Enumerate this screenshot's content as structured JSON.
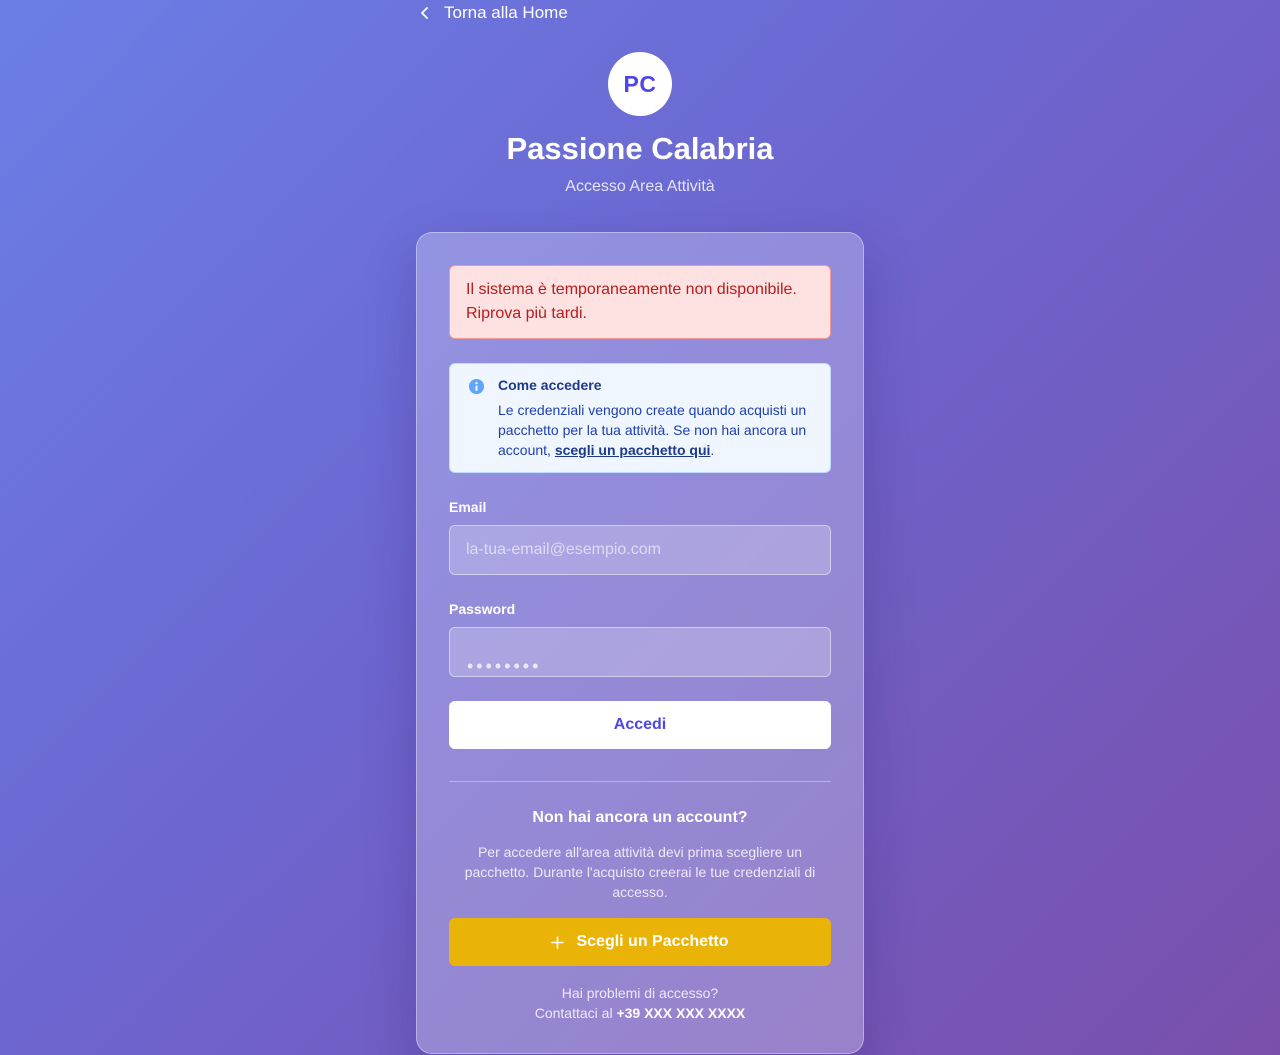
{
  "nav": {
    "back_label": "Torna alla Home"
  },
  "brand": {
    "logo_text": "PC",
    "title": "Passione Calabria",
    "subtitle": "Accesso Area Attività"
  },
  "error": {
    "message": "Il sistema è temporaneamente non disponibile. Riprova più tardi."
  },
  "info": {
    "icon": "info-circle-icon",
    "title": "Come accedere",
    "text": "Le credenziali vengono create quando acquisti un pacchetto per la tua attività. Se non hai ancora un account, ",
    "link_label": "scegli un pacchetto qui",
    "text_end": "."
  },
  "form": {
    "email_label": "Email",
    "email_placeholder": "la-tua-email@esempio.com",
    "email_value": "",
    "password_label": "Password",
    "password_placeholder": "••••••••",
    "password_value": "",
    "submit_label": "Accedi"
  },
  "signup": {
    "title": "Non hai ancora un account?",
    "description": "Per accedere all'area attività devi prima scegliere un pacchetto. Durante l'acquisto creerai le tue credenziali di accesso.",
    "button_label": "Scegli un Pacchetto",
    "button_icon": "plus-icon"
  },
  "help": {
    "question": "Hai problemi di accesso?",
    "contact_prefix": "Contattaci al ",
    "phone": "+39 XXX XXX XXXX"
  },
  "colors": {
    "accent": "#4f46e5",
    "package_button": "#eab308",
    "error_text": "#b91c1c",
    "error_bg": "#fee2e2",
    "info_bg": "#eff6ff"
  }
}
